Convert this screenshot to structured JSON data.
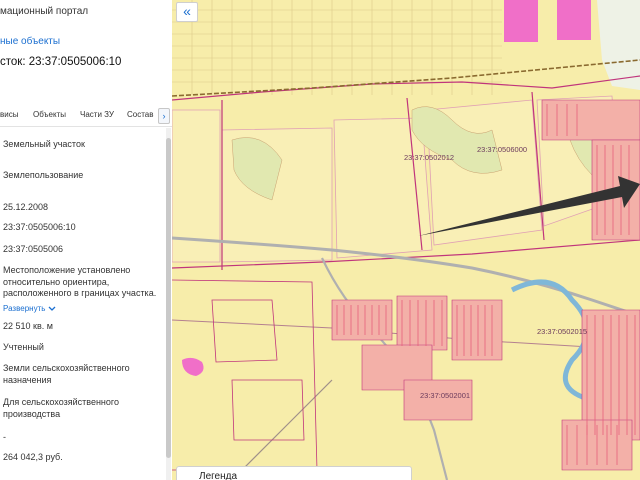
{
  "panel": {
    "portal_title": "мационный портал",
    "nearby_link": "ные объекты",
    "parcel_heading": "сток: 23:37:0505006:10",
    "tabs": [
      "висы",
      "Объекты",
      "Части ЗУ",
      "Состав"
    ],
    "fields": {
      "object_type": "Земельный участок",
      "category": "Землепользование",
      "date": "25.12.2008",
      "cadastral_number": "23:37:0505006:10",
      "quarter": "23:37:0505006",
      "location": "Местоположение установлено относительно ориентира, расположенного в границах участка.",
      "expand": "Развернуть",
      "area": "22 510 кв. м",
      "status": "Учтенный",
      "land_category": "Земли сельскохозяйственного назначения",
      "permitted_use": "Для сельскохозяйственного производства",
      "dash": "-",
      "cadastral_value": "264 042,3 руб."
    }
  },
  "map": {
    "collapse_symbol": "«",
    "legend_label": "Легенда",
    "labels": [
      "23:37:0502012",
      "23:37:0506000",
      "23:37:0502015",
      "23:37:0502001"
    ],
    "colors": {
      "base": "#f7edaa",
      "parcel_border": "#c0357c",
      "quarter_border": "#e0a0b4",
      "dense": "#e8607a",
      "pink_area": "#f06fc8",
      "water": "#b7d8ea",
      "road": "#b0b0b0",
      "arrow": "#333333",
      "link": "#1b6fd0"
    }
  }
}
